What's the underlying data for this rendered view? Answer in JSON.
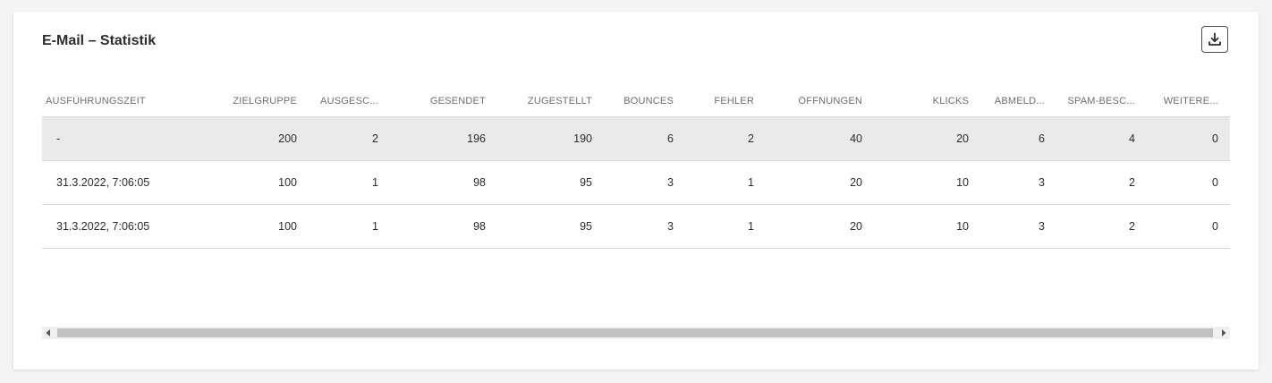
{
  "card": {
    "title": "E-Mail – Statistik",
    "download_icon": "download-icon"
  },
  "table": {
    "columns": [
      "AUSFÜHRUNGSZEIT",
      "ZIELGRUPPE",
      "AUSGESC...",
      "GESENDET",
      "ZUGESTELLT",
      "BOUNCES",
      "FEHLER",
      "ÖFFNUNGEN",
      "KLICKS",
      "ABMELD...",
      "SPAM-BESC...",
      "WEITERE..."
    ],
    "rows": [
      [
        "-",
        "200",
        "2",
        "196",
        "190",
        "6",
        "2",
        "40",
        "20",
        "6",
        "4",
        "0"
      ],
      [
        "31.3.2022, 7:06:05",
        "100",
        "1",
        "98",
        "95",
        "3",
        "1",
        "20",
        "10",
        "3",
        "2",
        "0"
      ],
      [
        "31.3.2022, 7:06:05",
        "100",
        "1",
        "98",
        "95",
        "3",
        "1",
        "20",
        "10",
        "3",
        "2",
        "0"
      ]
    ]
  },
  "scrollbar": {
    "left_icon": "arrow-left-icon",
    "right_icon": "arrow-right-icon"
  },
  "colors": {
    "total_row_bg": "#eaeaea",
    "border": "#d8d8d8",
    "header_text": "#6e6e6e",
    "body_text": "#2c2c2c"
  }
}
